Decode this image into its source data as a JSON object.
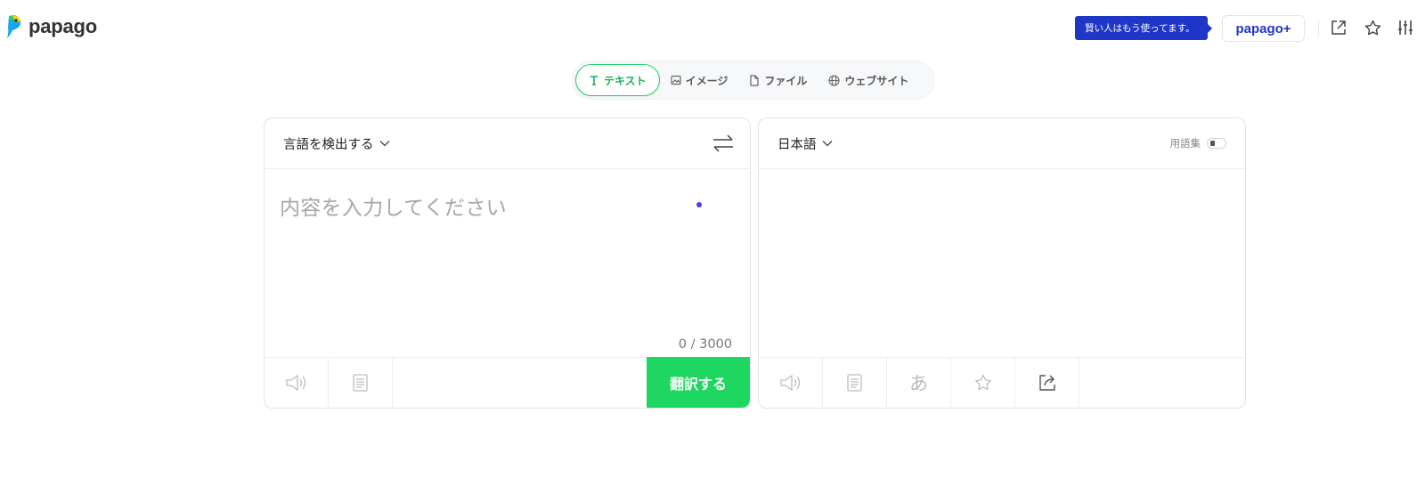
{
  "header": {
    "logo_text": "papago",
    "promo_text": "賢い人はもう使ってます。",
    "plus_label": "papago+",
    "brand_colors": {
      "green": "#1ed760",
      "blue": "#1f37c9",
      "yellow": "#ffd400"
    }
  },
  "tabs": [
    {
      "label": "テキスト",
      "icon": "text-icon",
      "active": true
    },
    {
      "label": "イメージ",
      "icon": "image-icon",
      "active": false
    },
    {
      "label": "ファイル",
      "icon": "file-icon",
      "active": false
    },
    {
      "label": "ウェブサイト",
      "icon": "globe-icon",
      "active": false
    }
  ],
  "source": {
    "language": "言語を検出する",
    "placeholder": "内容を入力してください",
    "counter": "0 / 3000",
    "translate_label": "翻訳する"
  },
  "target": {
    "language": "日本語",
    "glossary_label": "用語集"
  }
}
